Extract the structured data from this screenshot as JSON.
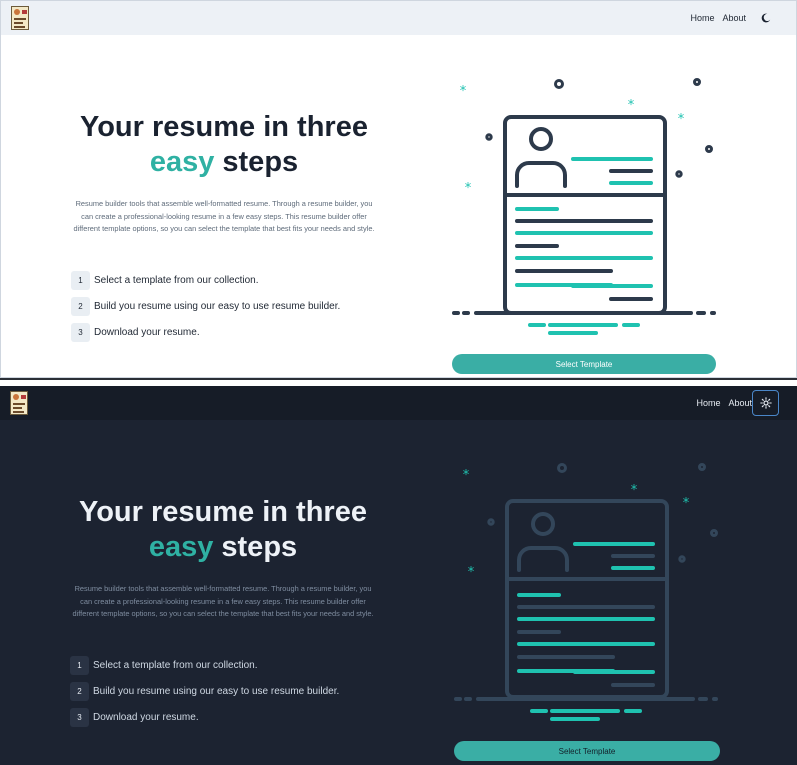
{
  "nav": {
    "home": "Home",
    "about": "About"
  },
  "hero": {
    "title_line1": "Your resume in three",
    "title_accent": "easy",
    "title_rest": " steps",
    "description": "Resume builder tools that assemble well-formatted resume. Through a resume builder, you can create a professional-looking resume in a few easy steps. This resume builder offer different template options, so you can select the template that best fits your needs and style."
  },
  "steps": [
    {
      "num": "1",
      "text": "Select a template from our collection."
    },
    {
      "num": "2",
      "text": "Build you resume using our easy to use resume builder."
    },
    {
      "num": "3",
      "text": "Download your resume."
    }
  ],
  "cta": {
    "label": "Select Template"
  },
  "icons": {
    "logo": "resume-logo-icon",
    "light_toggle": "moon-icon",
    "dark_toggle": "sun-icon"
  },
  "colors": {
    "accent": "#2fb1a3",
    "button": "#3aaea5",
    "dark_bg": "#1c2331",
    "light_bg": "#ffffff",
    "outline_light": "#2d3a4b",
    "outline_dark": "#33465a"
  }
}
